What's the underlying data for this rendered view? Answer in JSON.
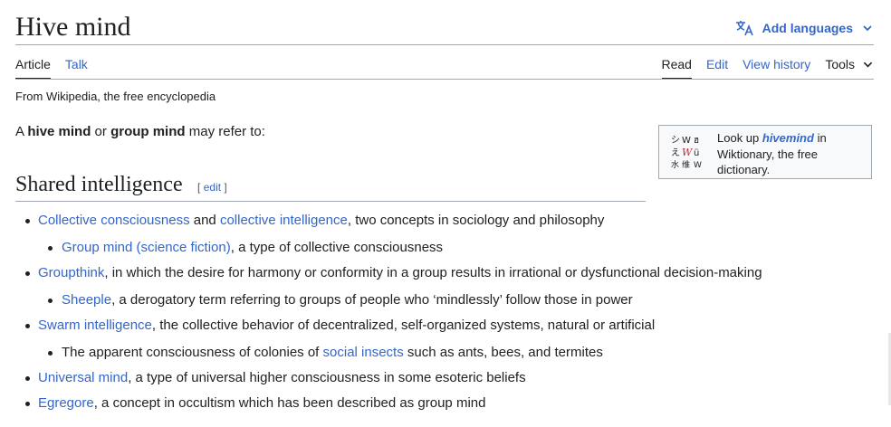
{
  "page": {
    "title": "Hive mind",
    "add_languages": "Add languages",
    "tabs_left": [
      "Article",
      "Talk"
    ],
    "tabs_right": [
      "Read",
      "Edit",
      "View history",
      "Tools"
    ],
    "tagline": "From Wikipedia, the free encyclopedia"
  },
  "intro": {
    "a": "A ",
    "term1": "hive mind",
    "or": " or ",
    "term2": "group mind",
    "rest": " may refer to:"
  },
  "wiktionary": {
    "pre": "Look up ",
    "term": "hivemind",
    "post": " in Wiktionary, the free dictionary."
  },
  "section": {
    "heading": "Shared intelligence",
    "edit_open": "[ ",
    "edit_label": "edit",
    "edit_close": " ]"
  },
  "items": {
    "i1": {
      "link1": "Collective consciousness",
      "and": " and ",
      "link2": "collective intelligence",
      "rest": ", two concepts in sociology and philosophy"
    },
    "i1a": {
      "link": "Group mind (science fiction)",
      "rest": ", a type of collective consciousness"
    },
    "i2": {
      "link": "Groupthink",
      "rest": ", in which the desire for harmony or conformity in a group results in irrational or dysfunctional decision-making"
    },
    "i2a": {
      "link": "Sheeple",
      "rest": ", a derogatory term referring to groups of people who ‘mindlessly’ follow those in power"
    },
    "i3": {
      "link": "Swarm intelligence",
      "rest": ", the collective behavior of decentralized, self-organized systems, natural or artificial"
    },
    "i3a": {
      "pre": "The apparent consciousness of colonies of ",
      "link": "social insects",
      "rest": " such as ants, bees, and termites"
    },
    "i4": {
      "link": "Universal mind",
      "rest": ", a type of universal higher consciousness in some esoteric beliefs"
    },
    "i5": {
      "link": "Egregore",
      "rest": ", a concept in occultism which has been described as group mind"
    }
  },
  "icons": [
    "translate-icon",
    "chevron-down-icon",
    "wiktionary-logo-icon"
  ],
  "colors": {
    "link": "#3366cc",
    "text": "#202122",
    "border": "#a2a9b1",
    "box_bg": "#f8f9fa"
  }
}
